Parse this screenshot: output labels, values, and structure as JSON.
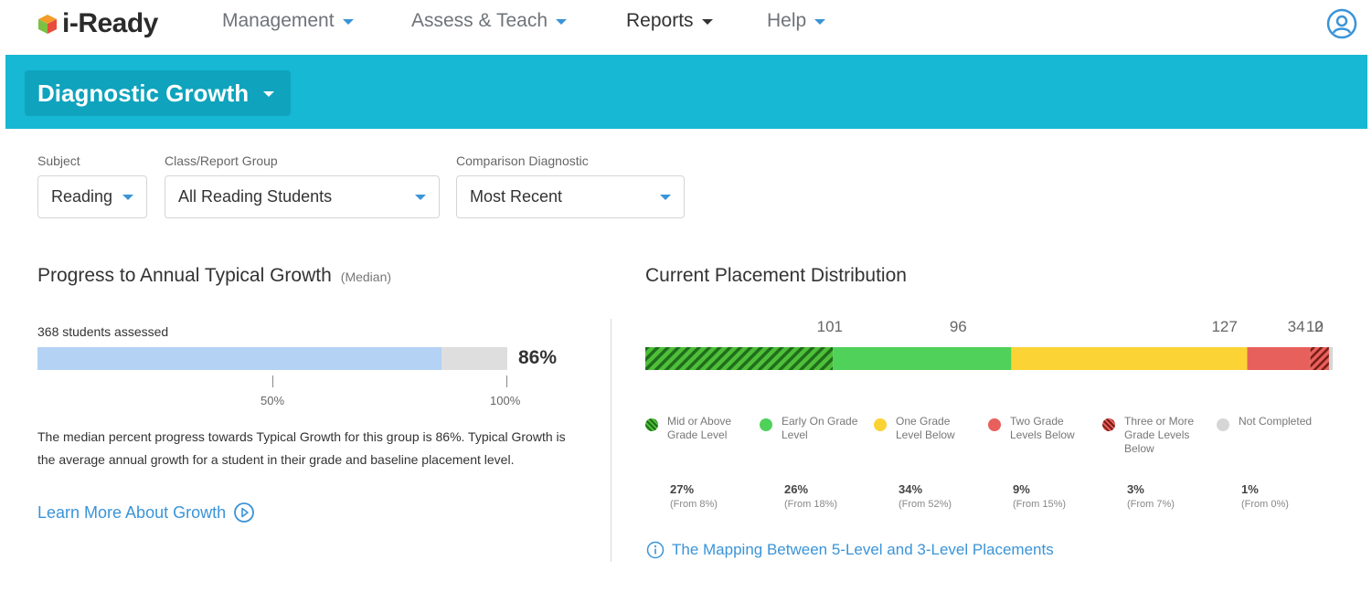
{
  "brand": {
    "name": "i-Ready"
  },
  "nav": {
    "items": [
      {
        "label": "Management"
      },
      {
        "label": "Assess & Teach"
      },
      {
        "label": "Reports"
      },
      {
        "label": "Help"
      }
    ],
    "active": "Reports",
    "user_icon": "user-circle-icon"
  },
  "banner": {
    "title": "Diagnostic Growth"
  },
  "filters": {
    "subject": {
      "label": "Subject",
      "value": "Reading"
    },
    "group": {
      "label": "Class/Report Group",
      "value": "All Reading Students"
    },
    "comparison": {
      "label": "Comparison Diagnostic",
      "value": "Most Recent"
    }
  },
  "progress": {
    "title": "Progress to Annual Typical Growth",
    "subtitle": "(Median)",
    "assessed": "368 students assessed",
    "percent_label": "86%",
    "value": 0.86,
    "ticks": [
      {
        "label": "50%",
        "value": 0.5
      },
      {
        "label": "100%",
        "value": 1.0
      }
    ],
    "description": "The median percent progress towards Typical Growth for this group is 86%. Typical Growth is the average annual growth for a student in their grade and baseline placement level.",
    "learn_more": "Learn More About Growth"
  },
  "placement": {
    "title": "Current Placement Distribution",
    "mapping_link": "The Mapping Between 5-Level and 3-Level Placements"
  },
  "chart_data": {
    "type": "bar",
    "orientation": "horizontal-stacked",
    "title": "Current Placement Distribution",
    "categories": [
      "Mid or Above Grade Level",
      "Early On Grade Level",
      "One Grade Level Below",
      "Two Grade Levels Below",
      "Three or More Grade Levels Below",
      "Not Completed"
    ],
    "values": [
      101,
      96,
      127,
      34,
      10,
      2
    ],
    "percents": [
      "27%",
      "26%",
      "34%",
      "9%",
      "3%",
      "1%"
    ],
    "from": [
      "(From 8%)",
      "(From 18%)",
      "(From 52%)",
      "(From 15%)",
      "(From 7%)",
      "(From 0%)"
    ],
    "colors": [
      "#2e9e2e",
      "#4fd15a",
      "#fbd335",
      "#e8605c",
      "#c0392b",
      "#d6d6d6"
    ],
    "patterns": [
      "hatch",
      "solid",
      "solid",
      "solid",
      "hatch",
      "solid"
    ]
  }
}
